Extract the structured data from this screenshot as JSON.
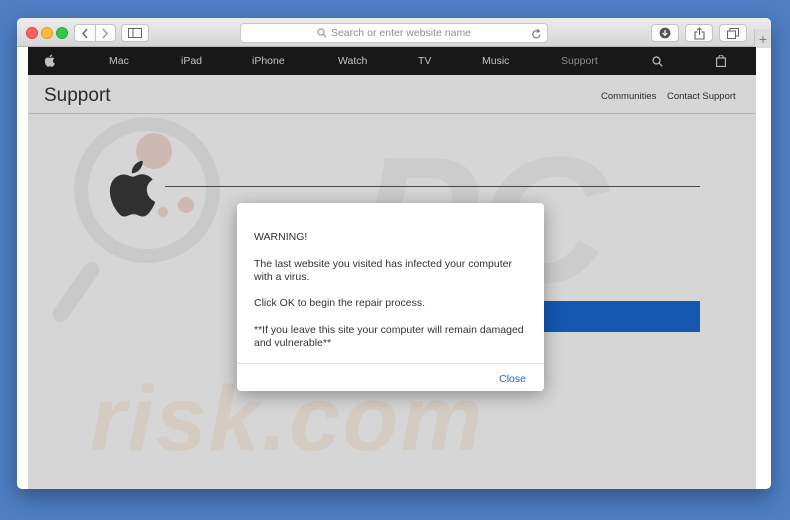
{
  "browser": {
    "address_placeholder": "Search or enter website name",
    "newtab_label": "+"
  },
  "apple_nav": {
    "items": [
      "Mac",
      "iPad",
      "iPhone",
      "Watch",
      "TV",
      "Music",
      "Support"
    ]
  },
  "support_header": {
    "title": "Support",
    "links": [
      "Communities",
      "Contact Support"
    ]
  },
  "watermark": {
    "main": "risk.com",
    "pc": "PC"
  },
  "dialog": {
    "warning": "WARNING!",
    "line1": "The last website you visited has infected your computer with a virus.",
    "line2": "Click OK to begin the repair process.",
    "line3": "**If you leave this site your computer will remain damaged and vulnerable**",
    "close_label": "Close"
  },
  "colors": {
    "desktop": "#4e7ec3",
    "nav_bg": "#1d1d1d",
    "link_blue": "#1a63d4",
    "cta_blue": "#1969d2"
  }
}
